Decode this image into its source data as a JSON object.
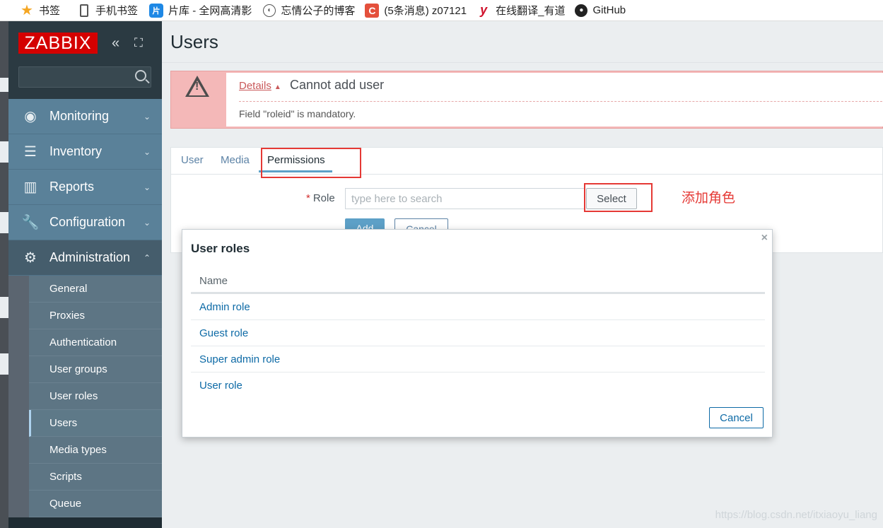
{
  "bookmarks": [
    {
      "icon": "star-icon",
      "glyph": "★",
      "label": "书签"
    },
    {
      "icon": "phone-icon",
      "glyph": "",
      "label": "手机书签"
    },
    {
      "icon": "pianku-icon",
      "glyph": "片",
      "label": "片库 - 全网高清影"
    },
    {
      "icon": "globe-icon",
      "glyph": "◐",
      "label": "忘情公子的博客"
    },
    {
      "icon": "csdn-icon",
      "glyph": "C",
      "label": "(5条消息) z07121"
    },
    {
      "icon": "youdao-icon",
      "glyph": "y",
      "label": "在线翻译_有道"
    },
    {
      "icon": "github-icon",
      "glyph": "●",
      "label": "GitHub"
    }
  ],
  "sidebar": {
    "logo": "ZABBIX",
    "collapse_glyph": "«",
    "kiosk_glyph": "⛶",
    "menu": [
      {
        "label": "Monitoring",
        "icon_glyph": "◉",
        "chevron": "⌄"
      },
      {
        "label": "Inventory",
        "icon_glyph": "☰",
        "chevron": "⌄"
      },
      {
        "label": "Reports",
        "icon_glyph": "▥",
        "chevron": "⌄"
      },
      {
        "label": "Configuration",
        "icon_glyph": "🔧",
        "chevron": "⌄"
      },
      {
        "label": "Administration",
        "icon_glyph": "⚙",
        "chevron": "⌃"
      }
    ],
    "submenu": [
      "General",
      "Proxies",
      "Authentication",
      "User groups",
      "User roles",
      "Users",
      "Media types",
      "Scripts",
      "Queue"
    ]
  },
  "main": {
    "title": "Users",
    "error": {
      "details_label": "Details",
      "title": "Cannot add user",
      "message": "Field \"roleid\" is mandatory."
    },
    "tabs": [
      "User",
      "Media",
      "Permissions"
    ],
    "role_label": "Role",
    "role_placeholder": "type here to search",
    "select_label": "Select",
    "annotation": "添加角色",
    "add_label": "Add",
    "cancel_label": "Cancel"
  },
  "modal": {
    "title": "User roles",
    "column": "Name",
    "rows": [
      "Admin role",
      "Guest role",
      "Super admin role",
      "User role"
    ],
    "cancel_label": "Cancel",
    "close_glyph": "×"
  },
  "watermark": "https://blog.csdn.net/itxiaoyu_liang"
}
